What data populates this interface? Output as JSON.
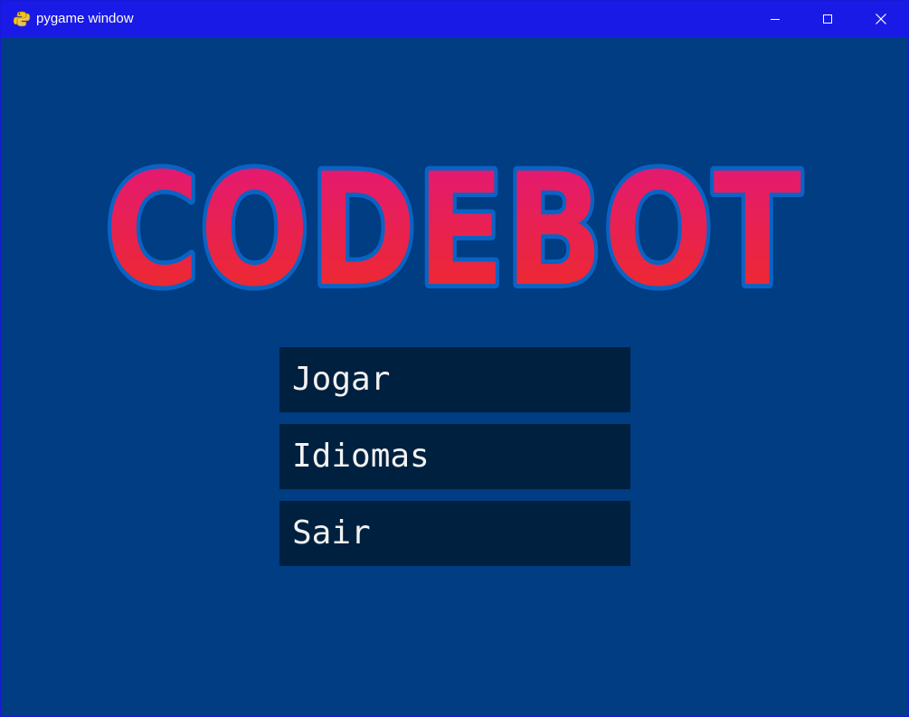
{
  "window": {
    "title": "pygame window",
    "icon": "pygame-snake-icon",
    "controls": {
      "minimize_icon": "minimize-icon",
      "maximize_icon": "maximize-icon",
      "close_icon": "close-icon"
    }
  },
  "game": {
    "logo_text": "CODEBOT",
    "menu": [
      {
        "label": "Jogar"
      },
      {
        "label": "Idiomas"
      },
      {
        "label": "Sair"
      }
    ]
  },
  "colors": {
    "titlebar": "#1a1ae6",
    "background": "#003d82",
    "button_bg": "#00203f",
    "button_text": "#f2f2f2",
    "logo_gradient_top": "#e2167f",
    "logo_gradient_bottom": "#ef2d20",
    "logo_outline": "#0a63c4"
  }
}
